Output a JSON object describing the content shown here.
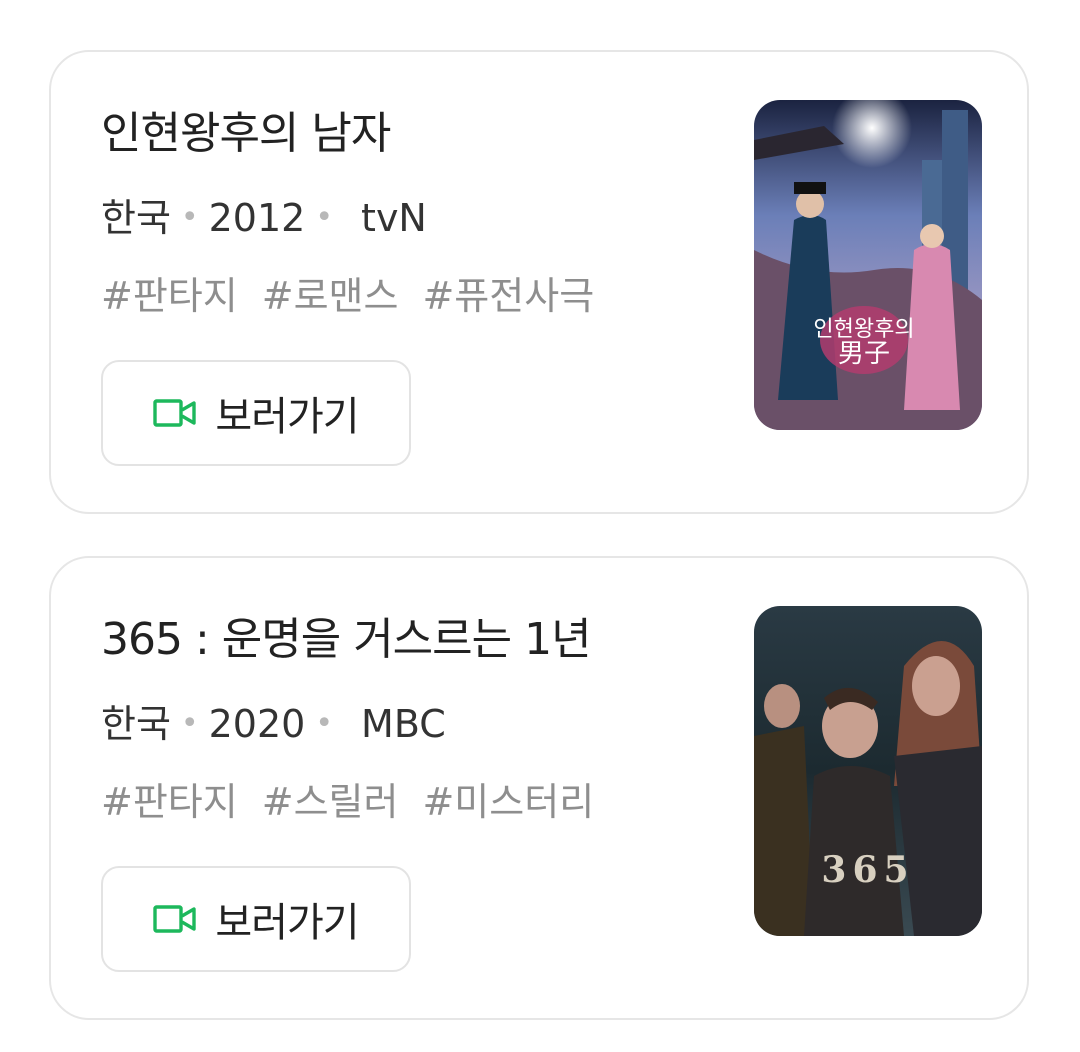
{
  "colors": {
    "accent_green": "#1db85c",
    "card_border": "#e6e6e6",
    "tag_gray": "#8e8e8e"
  },
  "items": [
    {
      "title": "인현왕후의 남자",
      "country": "한국",
      "year": "2012",
      "network": "tvN",
      "tags": [
        "#판타지",
        "#로맨스",
        "#퓨전사극"
      ],
      "watch_label": "보러가기",
      "watch_icon": "video-camera-icon",
      "poster_text": "인현왕후의\n男子"
    },
    {
      "title": "365 : 운명을 거스르는 1년",
      "country": "한국",
      "year": "2020",
      "network": "MBC",
      "tags": [
        "#판타지",
        "#스릴러",
        "#미스터리"
      ],
      "watch_label": "보러가기",
      "watch_icon": "video-camera-icon",
      "poster_text": "365"
    }
  ]
}
